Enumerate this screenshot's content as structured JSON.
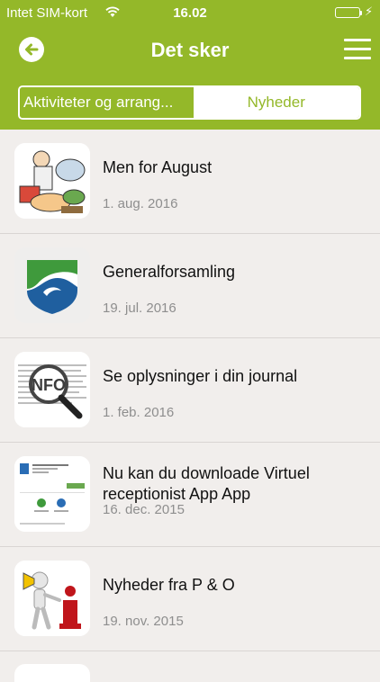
{
  "status_bar": {
    "carrier": "Intet SIM-kort",
    "time": "16.02",
    "battery_level": 1.0
  },
  "nav": {
    "title": "Det sker",
    "back_icon": "arrow-left-circle-icon",
    "menu_icon": "hamburger-menu-icon"
  },
  "tabs": [
    {
      "label": "Aktiviteter og arrang...",
      "active": true
    },
    {
      "label": "Nyheder",
      "active": false
    }
  ],
  "news": [
    {
      "title": "Men for August",
      "date": "1. aug. 2016",
      "icon": "kitchen-food-illustration"
    },
    {
      "title": "Generalforsamling",
      "date": "19. jul. 2016",
      "icon": "shield-wave-logo"
    },
    {
      "title": "Se oplysninger i din journal",
      "date": "1. feb. 2016",
      "icon": "magnifier-info-icon"
    },
    {
      "title": "Nu kan du downloade Virtuel receptionist  App App",
      "date": "16. dec. 2015",
      "icon": "app-store-screenshot"
    },
    {
      "title": "Nyheder fra P & O",
      "date": "19. nov. 2015",
      "icon": "megaphone-info-figure"
    }
  ],
  "colors": {
    "accent": "#94b829",
    "background": "#f1eeec",
    "date_text": "#8e8e8e"
  }
}
